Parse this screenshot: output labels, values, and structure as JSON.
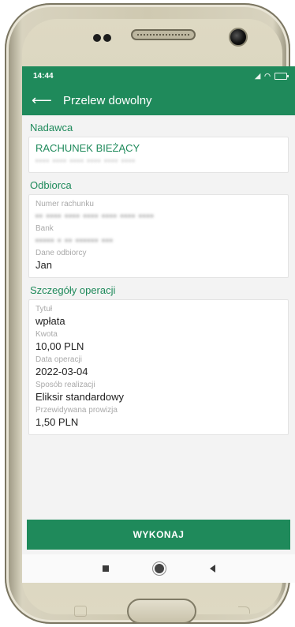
{
  "status": {
    "time": "14:44"
  },
  "appbar": {
    "back_icon": "arrow-left-icon",
    "title": "Przelew dowolny"
  },
  "sender": {
    "section_title": "Nadawca",
    "account_name": "RACHUNEK BIEŻĄCY"
  },
  "recipient": {
    "section_title": "Odbiorca",
    "account_number_label": "Numer rachunku",
    "bank_label": "Bank",
    "recipient_data_label": "Dane odbiorcy",
    "recipient_name": "Jan"
  },
  "details": {
    "section_title": "Szczegóły operacji",
    "title_label": "Tytuł",
    "title_value": "wpłata",
    "amount_label": "Kwota",
    "amount_value": "10,00 PLN",
    "date_label": "Data operacji",
    "date_value": "2022-03-04",
    "method_label": "Sposób realizacji",
    "method_value": "Eliksir standardowy",
    "fee_label": "Przewidywana prowizja",
    "fee_value": "1,50 PLN"
  },
  "actions": {
    "execute_label": "WYKONAJ"
  },
  "colors": {
    "brand": "#1f8a5b",
    "background": "#f3f3f3"
  }
}
